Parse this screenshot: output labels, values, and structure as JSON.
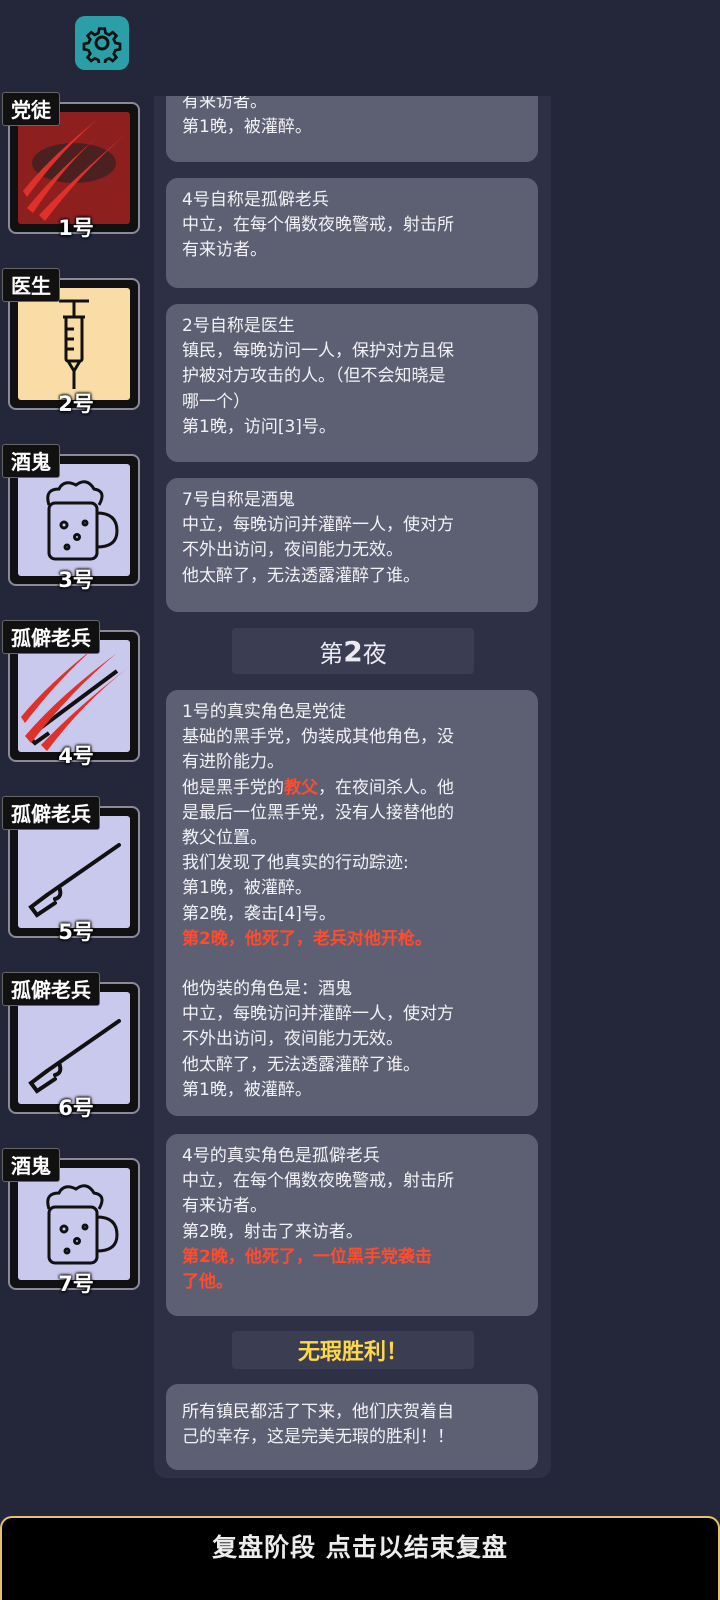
{
  "toolbar": {
    "settings_icon": "gear-icon"
  },
  "players": [
    {
      "role": "党徒",
      "number": "1号",
      "icon": "claw-marks-icon",
      "bg": "#8d1f1f"
    },
    {
      "role": "医生",
      "number": "2号",
      "icon": "syringe-icon",
      "bg": "#fadda6"
    },
    {
      "role": "酒鬼",
      "number": "3号",
      "icon": "beer-mug-icon",
      "bg": "#c9c9ee"
    },
    {
      "role": "孤僻老兵",
      "number": "4号",
      "icon": "rifle-claw-icon",
      "bg": "#c9c9ee"
    },
    {
      "role": "孤僻老兵",
      "number": "5号",
      "icon": "rifle-icon",
      "bg": "#c9c9ee"
    },
    {
      "role": "孤僻老兵",
      "number": "6号",
      "icon": "rifle-icon",
      "bg": "#c9c9ee"
    },
    {
      "role": "酒鬼",
      "number": "7号",
      "icon": "beer-mug-icon",
      "bg": "#c9c9ee"
    }
  ],
  "log": {
    "msg0": {
      "l1": "有来访者。",
      "l2": "第1晚，被灌醉。"
    },
    "msg1": {
      "l1": "4号自称是孤僻老兵",
      "l2": "中立，在每个偶数夜晚警戒，射击所\n有来访者。"
    },
    "msg2": {
      "l1": "2号自称是医生",
      "l2": "镇民，每晚访问一人，保护对方且保\n护被对方攻击的人。（但不会知晓是\n哪一个）",
      "l3": "第1晚，访问[3]号。"
    },
    "msg3": {
      "l1": "7号自称是酒鬼",
      "l2": "中立，每晚访问并灌醉一人，使对方\n不外出访问，夜间能力无效。",
      "l3": "他太醉了，无法透露灌醉了谁。"
    },
    "night2": {
      "prefix": "第",
      "num": "2",
      "suffix": "夜"
    },
    "msg4": {
      "l1": "1号的真实角色是党徒",
      "l2": "基础的黑手党，伪装成其他角色，没\n有进阶能力。",
      "l3a": "他是黑手党的",
      "l3b": "教父",
      "l3c": "，在夜间杀人。他\n是最后一位黑手党，没有人接替他的\n教父位置。",
      "l4": "我们发现了他真实的行动踪迹:",
      "l5": "第1晚，被灌醉。",
      "l6": "第2晚，袭击[4]号。",
      "l7": "第2晚，他死了，老兵对他开枪。",
      "l8": "他伪装的角色是：酒鬼",
      "l9": "中立，每晚访问并灌醉一人，使对方\n不外出访问，夜间能力无效。",
      "l10": "他太醉了，无法透露灌醉了谁。",
      "l11": "第1晚，被灌醉。"
    },
    "msg5": {
      "l1": "4号的真实角色是孤僻老兵",
      "l2": "中立，在每个偶数夜晚警戒，射击所\n有来访者。",
      "l3": "第2晚，射击了来访者。",
      "l4": "第2晚，他死了，一位黑手党袭击\n了他。"
    },
    "win_title": "无瑕胜利！",
    "msg6": {
      "l1": "所有镇民都活了下来，他们庆贺着自\n己的幸存，这是完美无瑕的胜利！！"
    }
  },
  "bottom_bar": {
    "label": "复盘阶段 点击以结束复盘"
  },
  "colors": {
    "accent_red": "#ff4b2e",
    "win_gold": "#ffd84a",
    "settings_teal": "#2a9fa8"
  }
}
